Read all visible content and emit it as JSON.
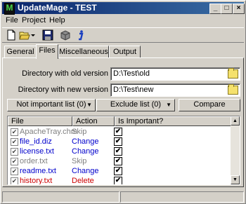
{
  "window": {
    "title": "UpdateMage - TEST",
    "app_icon_letter": "M",
    "minimize": "_",
    "maximize": "□",
    "close": "×"
  },
  "menu": [
    "File",
    "Project",
    "Help"
  ],
  "toolbar": {
    "tools": [
      "new-file-icon",
      "open-folder-icon",
      "dropdown-arrow-icon",
      "save-icon",
      "package-icon",
      "info-icon"
    ]
  },
  "tabs": [
    {
      "label": "General",
      "active": false
    },
    {
      "label": "Files",
      "active": true
    },
    {
      "label": "Miscellaneous",
      "active": false
    },
    {
      "label": "Output",
      "active": false
    }
  ],
  "files_tab": {
    "old_dir_label": "Directory with old version",
    "old_dir_value": "D:\\Test\\old",
    "new_dir_label": "Directory with new version",
    "new_dir_value": "D:\\Test\\new",
    "not_important_button": "Not important list (0)",
    "exclude_button": "Exclude list (0)",
    "compare_button": "Compare"
  },
  "file_list": {
    "columns": [
      "File",
      "Action",
      "Is Important?"
    ],
    "rows": [
      {
        "file": "ApacheTray.chm",
        "action": "Skip",
        "color": "#808080",
        "checked": true,
        "important": true
      },
      {
        "file": "file_id.diz",
        "action": "Change",
        "color": "#0000cc",
        "checked": true,
        "important": true
      },
      {
        "file": "license.txt",
        "action": "Change",
        "color": "#0000cc",
        "checked": true,
        "important": true
      },
      {
        "file": "order.txt",
        "action": "Skip",
        "color": "#808080",
        "checked": true,
        "important": true
      },
      {
        "file": "readme.txt",
        "action": "Change",
        "color": "#0000cc",
        "checked": true,
        "important": true
      },
      {
        "file": "history.txt",
        "action": "Delete",
        "color": "#cc0000",
        "checked": true,
        "important": true
      }
    ]
  },
  "colors": {
    "title_start": "#0a246a",
    "title_end": "#3a6ea5",
    "face": "#d4d0c8"
  }
}
